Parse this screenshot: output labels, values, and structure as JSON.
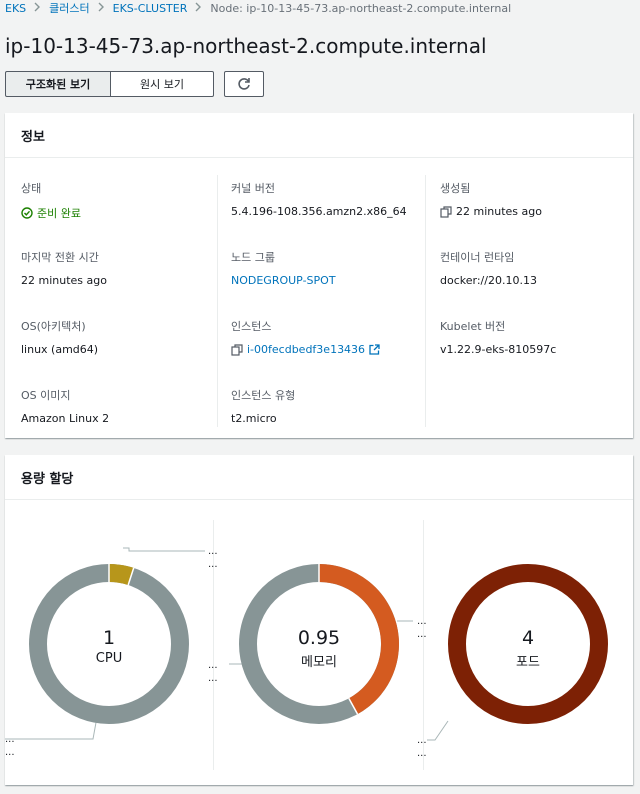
{
  "breadcrumb": {
    "items": [
      "EKS",
      "클러스터",
      "EKS-CLUSTER"
    ],
    "current": "Node: ip-10-13-45-73.ap-northeast-2.compute.internal"
  },
  "title": "ip-10-13-45-73.ap-northeast-2.compute.internal",
  "view_toggle": {
    "structured": "구조화된 보기",
    "raw": "원시 보기"
  },
  "refresh_icon": "refresh-icon",
  "info": {
    "header": "정보",
    "status_label": "상태",
    "status_value": "준비 완료",
    "kernel_label": "커널 버전",
    "kernel_value": "5.4.196-108.356.amzn2.x86_64",
    "created_label": "생성됨",
    "created_value": "22 minutes ago",
    "last_transition_label": "마지막 전환 시간",
    "last_transition_value": "22 minutes ago",
    "nodegroup_label": "노드 그룹",
    "nodegroup_value": "NODEGROUP-SPOT",
    "runtime_label": "컨테이너 런타임",
    "runtime_value": "docker://20.10.13",
    "os_label": "OS(아키텍처)",
    "os_value": "linux (amd64)",
    "instance_label": "인스턴스",
    "instance_value": "i-00fecdbedf3e13436",
    "kubelet_label": "Kubelet 버전",
    "kubelet_value": "v1.22.9-eks-810597c",
    "os_image_label": "OS 이미지",
    "os_image_value": "Amazon Linux 2",
    "instance_type_label": "인스턴스 유형",
    "instance_type_value": "t2.micro"
  },
  "capacity": {
    "header": "용량 할당",
    "ellipsis": "...",
    "colors": {
      "gray": "#879596",
      "gold": "#b7961b",
      "orange": "#d45b20",
      "maroon": "#7d2105"
    },
    "charts": [
      {
        "value": "1",
        "label": "CPU",
        "allocated_fraction": 0.05
      },
      {
        "value": "0.95",
        "label": "메모리",
        "allocated_fraction": 0.42
      },
      {
        "value": "4",
        "label": "포드",
        "allocated_fraction": 1.0
      }
    ]
  }
}
